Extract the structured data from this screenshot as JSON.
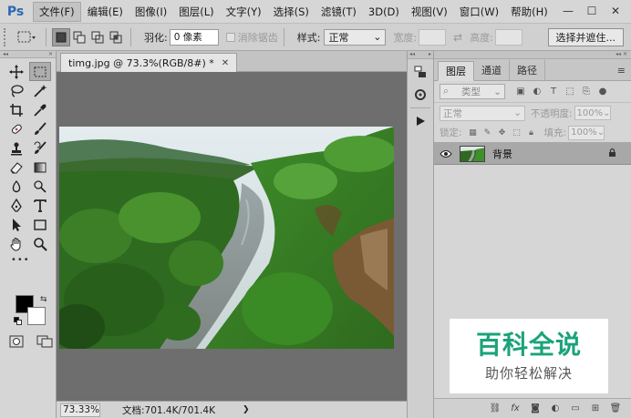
{
  "app": {
    "logo": "Ps",
    "menus": [
      "文件(F)",
      "编辑(E)",
      "图像(I)",
      "图层(L)",
      "文字(Y)",
      "选择(S)",
      "滤镜(T)",
      "3D(D)",
      "视图(V)",
      "窗口(W)",
      "帮助(H)"
    ],
    "active_menu_index": 0,
    "window_controls": [
      "—",
      "☐",
      "✕"
    ]
  },
  "options": {
    "feather_label": "羽化:",
    "feather_value": "0 像素",
    "antialias_label": "消除锯齿",
    "style_label": "样式:",
    "style_value": "正常",
    "width_label": "宽度:",
    "height_label": "高度:",
    "select_mask_button": "选择并遮住..."
  },
  "document": {
    "tab_title": "timg.jpg @ 73.3%(RGB/8#) *",
    "zoom": "73.33%",
    "doc_info": "文档:701.4K/701.4K"
  },
  "layers_panel": {
    "tabs": [
      "图层",
      "通道",
      "路径"
    ],
    "active_tab_index": 0,
    "filter_label": "类型",
    "blend_mode": "正常",
    "opacity_label": "不透明度:",
    "opacity_value": "100%",
    "lock_label": "锁定:",
    "fill_label": "填充:",
    "fill_value": "100%",
    "layers": [
      {
        "name": "背景",
        "visible": true,
        "locked": true
      }
    ]
  },
  "watermark": {
    "title": "百科全说",
    "subtitle": "助你轻松解决"
  },
  "colors": {
    "foreground": "#000000",
    "background": "#ffffff",
    "watermark_green": "#1aa37a"
  }
}
